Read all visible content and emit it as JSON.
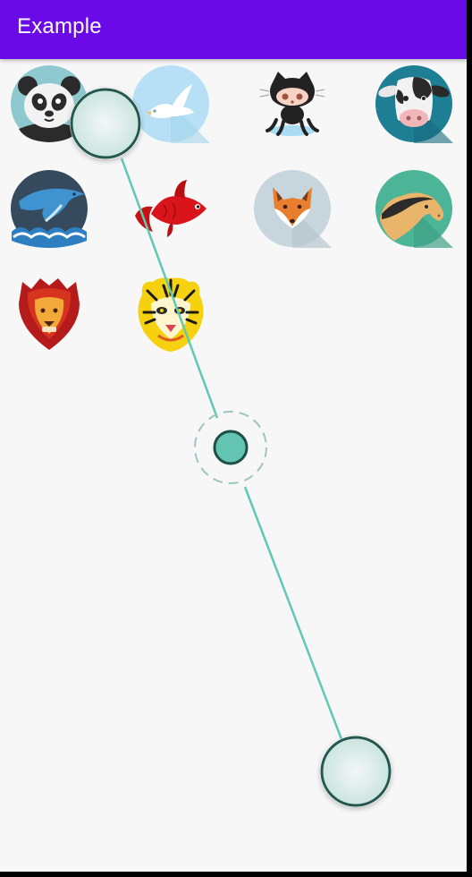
{
  "app_bar": {
    "title": "Example",
    "color": "#6a0ae6"
  },
  "animals": [
    {
      "name": "panda",
      "icon": "panda-icon"
    },
    {
      "name": "dove",
      "icon": "dove-icon"
    },
    {
      "name": "octocat",
      "icon": "octocat-icon"
    },
    {
      "name": "cow",
      "icon": "cow-icon"
    },
    {
      "name": "dolphin",
      "icon": "dolphin-icon"
    },
    {
      "name": "goldfish",
      "icon": "goldfish-icon"
    },
    {
      "name": "fox",
      "icon": "fox-icon"
    },
    {
      "name": "horse",
      "icon": "horse-icon"
    },
    {
      "name": "lion",
      "icon": "lion-icon"
    },
    {
      "name": "tiger",
      "icon": "tiger-icon"
    }
  ],
  "drag_overlay": {
    "line_color": "#5ec9b4",
    "knob_fill": "#63c4b2",
    "knob_stroke": "#1f4d47",
    "handle_stroke": "#24584f",
    "handle_fill": "#e9f2f0",
    "dashed_ring_color": "#9cc6bd"
  }
}
